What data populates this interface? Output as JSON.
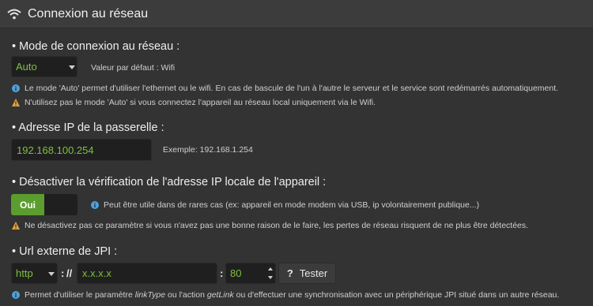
{
  "header": {
    "title": "Connexion au réseau",
    "icon": "wifi-icon"
  },
  "mode": {
    "title": "• Mode de connexion au réseau :",
    "select_value": "Auto",
    "default_text": "Valeur par défaut : Wifi",
    "info_note": "Le mode 'Auto' permet d'utiliser l'ethernet ou le wifi. En cas de bascule de l'un à l'autre le serveur et le service sont redémarrés automatiquement.",
    "warn_note": "N'utilisez pas le mode 'Auto' si vous connectez l'appareil au réseau local uniquement via le Wifi."
  },
  "gateway": {
    "title": "• Adresse IP de la passerelle :",
    "value": "192.168.100.254",
    "example": "Exemple: 192.168.1.254"
  },
  "disable_check": {
    "title": "• Désactiver la vérification de l'adresse IP locale de l'appareil :",
    "toggle_label": "Oui",
    "info_text": "Peut être utile dans de rares cas (ex: appareil en mode modem via USB, ip volontairement publique...)",
    "warn_note": "Ne désactivez pas ce paramètre si vous n'avez pas une bonne raison de le faire, les pertes de réseau risquent de ne plus être détectées."
  },
  "jpi": {
    "title": "• Url externe de JPI :",
    "protocol": "http",
    "sep1": ":",
    "slashes": "//",
    "host": "x.x.x.x",
    "sep2": ":",
    "port": "80",
    "test_q": "?",
    "test_label": "Tester",
    "info_a": "Permet d'utiliser le paramètre ",
    "info_b": "linkType",
    "info_c": " ou l'action ",
    "info_d": "getLink",
    "info_e": " ou d'effectuer une synchronisation avec un périphérique JPI situé dans un autre réseau."
  },
  "colors": {
    "accent_green": "#7ec13f",
    "info_blue": "#4aa3df",
    "warn_orange": "#e0a23a",
    "toggle_green": "#5c9d2f"
  }
}
